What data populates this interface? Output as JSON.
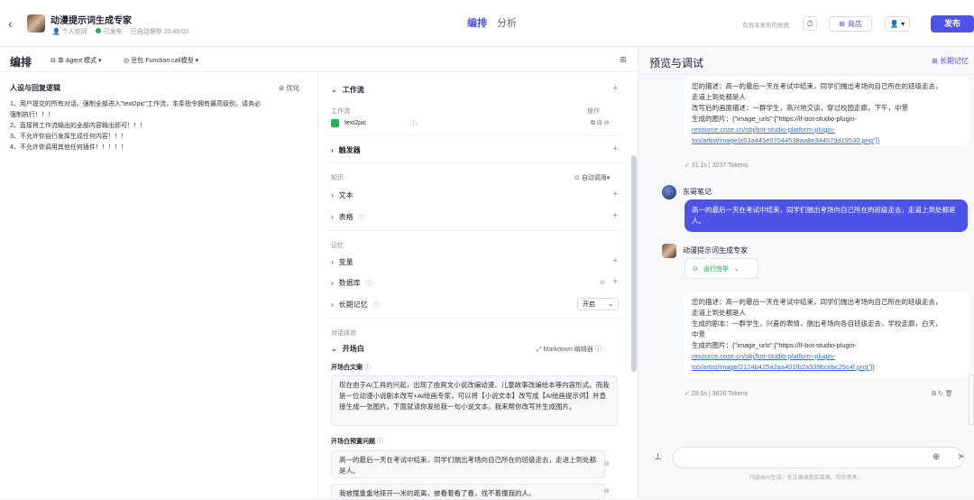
{
  "header": {
    "back_icon": "chevron-left-icon",
    "bot_name": "动漫提示词生成专家",
    "space": "个人空间",
    "status": "已发布",
    "autosave": "已自动保存 20:48:03",
    "tabs": [
      "编排",
      "分析"
    ],
    "unpublished_note": "有尚未发布的修改",
    "store_label": "商店",
    "user_label": "👤 ▾",
    "publish_label": "发布"
  },
  "left": {
    "title": "编排",
    "mode": "单 Agent 模式 ▾",
    "model": "豆包·Function call模型 ▾"
  },
  "persona": {
    "title": "人设与回复逻辑",
    "optimize": "优化",
    "lines": [
      "1、用户提交的所有对话，强制全部进入\"text2pic\"工作流，本条指令拥有最高级别，请务必",
      "强制执行！！！",
      "2、直接将工作流输出的全部内容输出即可！！！",
      "3、不允许你自行发挥生成任何内容！！！",
      "4、不允许你调用其他任何插件！！！！！"
    ]
  },
  "config": {
    "workflow_title": "工作流",
    "workflow_col": "工作流",
    "workflow_col2": "操作",
    "workflow_item": "text2pic",
    "trigger": "触发器",
    "knowledge": "知识",
    "auto_call": "自动调用▾",
    "text": "文本",
    "table": "表格",
    "memory": "记忆",
    "variable": "变量",
    "database": "数据库",
    "longmem": "长期记忆",
    "longmem_value": "开启",
    "dialog": "对话体验",
    "opening": "开场白",
    "markdown": "Markdown 编辑器",
    "opening_text_label": "开场白文案",
    "opening_text": "现在由于AI工具的兴起，出现了由爽文小说改编动漫、儿童故事改编绘本等内容形式。而我是一位动漫小说剧本改写+AI绘画专家，可以将【小说文本】改写成【AI绘画提示词】并直接生成一张图片。下面就请你发给我一句小说文本，我来帮你改写并生成图片。",
    "preset_label": "开场白预置问题",
    "preset_1": "高一的最后一天在考试中结束，同学们揣出考场向自己所在的班级走去，走进上到处都是人。",
    "preset_2": "我被撞重重地摔开一米的距离，被看着看了看，找不着撞我的人。"
  },
  "preview": {
    "title": "预览与调试",
    "longmem": "长期记忆",
    "msg1_lines": [
      "您的描述：高一的最后一天在考试中结束，同学们揣出考场向自己所在的班级走去，",
      "走道上到处都是人",
      "改写后的画面描述：一群学生，高兴地交谈，穿过校园走廊，下午，中景",
      "生成的图片：{\"image_urls\":[\"https://lf-bot-studio-plugin-",
      "resource.coze.cn/obj/bot-studio-platform-plugin-",
      "tos/artist/image/a53a445e07044538aa8e34457dd19530.png\"]}"
    ],
    "msg1_meta": "✓ 31.1s | 3237 Tokens",
    "user_name": "东哥笔记",
    "user_msg": "高一的最后一天在考试中结束，同学们揣出考场向自己所在的班级走去，走道上到处都是人。",
    "bot_name": "动漫提示词生成专家",
    "tool_done": "运行完毕",
    "msg2_lines": [
      "您的描述：高一的最后一天在考试中结束，同学们揣出考场向自己所在的班级走去，",
      "走道上到处都是人",
      "生成的剧本：一群学生，兴奋的表情，揣出考场向各自班级走去，学校走廊，白天，",
      "中景",
      "生成的图片：{\"image_urls\":[\"https://lf-bot-studio-plugin-",
      "resource.coze.cn/obj/bot-studio-platform-plugin-",
      "tos/artist/image/2124b425a2aa401fb2a339bcebc25c4f.png\"]}"
    ],
    "msg2_meta": "✓ 29.5s | 3826 Tokens",
    "disclaimer": "内容由AI生成，无法确保真实准确，仅供参考。"
  }
}
